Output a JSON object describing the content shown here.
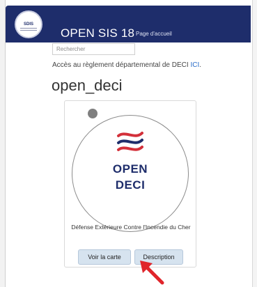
{
  "navbar": {
    "logo_text": "SDIS",
    "title": "OPEN SIS 18",
    "subtitle": "Page d'accueil"
  },
  "search": {
    "placeholder": "Rechercher"
  },
  "access_notice": {
    "text": "Accès au règlement départemental de DECI ",
    "link_label": "ICI",
    "suffix": "."
  },
  "page_heading": "open_deci",
  "app_card": {
    "logo_line1": "OPEN",
    "logo_line2": "DECI",
    "description": "Défense Extérieure Contre l'Incendie du Cher",
    "buttons": {
      "map_label": "Voir la carte",
      "description_label": "Description"
    }
  },
  "colors": {
    "navbar": "#1e2d6b",
    "logo_blue": "#1e2d6b",
    "flame_red": "#d3303a",
    "button_bg": "#d6e3ef",
    "link": "#2a6dc9",
    "arrow_red": "#e0252b"
  }
}
